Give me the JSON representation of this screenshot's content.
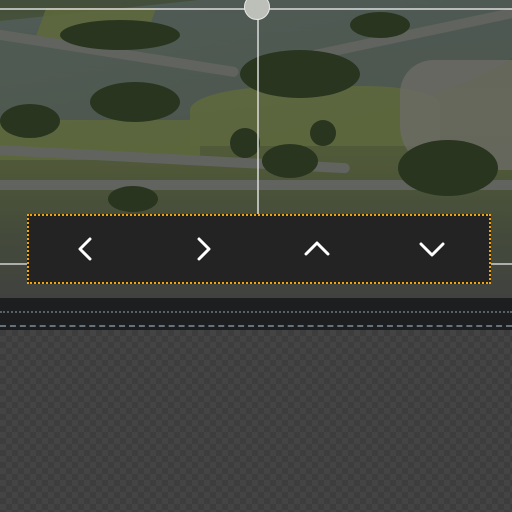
{
  "app": {
    "title": ""
  },
  "photo": {
    "description_icon": "landscape-photo"
  },
  "toolbar": {
    "accent_color": "#f2a40a",
    "buttons": [
      {
        "name": "previous",
        "icon": "chevron-left-icon",
        "label": ""
      },
      {
        "name": "next",
        "icon": "chevron-right-icon",
        "label": ""
      },
      {
        "name": "up",
        "icon": "chevron-up-icon",
        "label": ""
      },
      {
        "name": "down",
        "icon": "chevron-down-icon",
        "label": ""
      }
    ]
  }
}
